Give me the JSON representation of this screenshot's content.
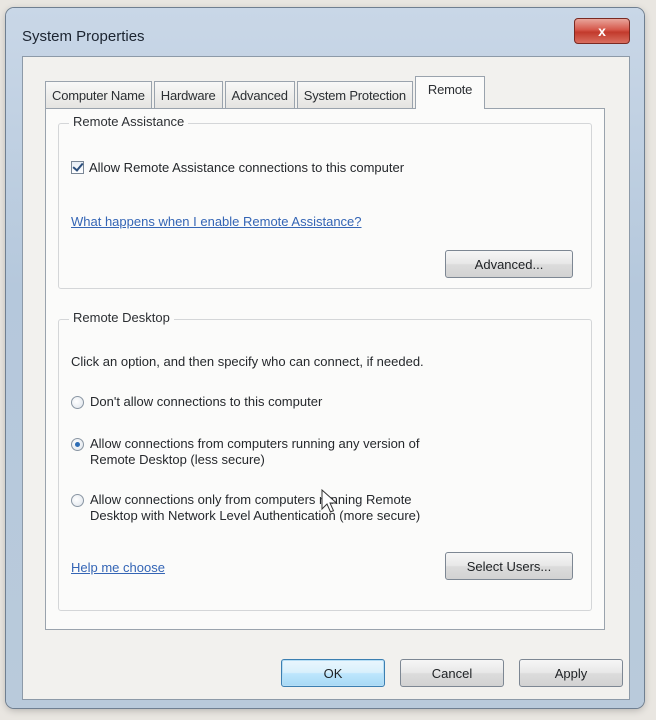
{
  "window": {
    "title": "System Properties",
    "close_label": "x"
  },
  "tabs": [
    {
      "label": "Computer Name",
      "active": false
    },
    {
      "label": "Hardware",
      "active": false
    },
    {
      "label": "Advanced",
      "active": false
    },
    {
      "label": "System Protection",
      "active": false
    },
    {
      "label": "Remote",
      "active": true
    }
  ],
  "remote_assistance": {
    "group_label": "Remote Assistance",
    "allow_checkbox_label": "Allow Remote Assistance connections to this computer",
    "allow_checked": true,
    "help_link": "What happens when I enable Remote Assistance?",
    "advanced_button": "Advanced..."
  },
  "remote_desktop": {
    "group_label": "Remote Desktop",
    "instructions": "Click an option, and then specify who can connect, if needed.",
    "options": [
      {
        "line1": "Don't allow connections to this computer",
        "line2": "",
        "selected": false
      },
      {
        "line1": "Allow connections from computers running any version of",
        "line2": "Remote Desktop (less secure)",
        "selected": true
      },
      {
        "line1": "Allow connections only from computers running Remote",
        "line2": "Desktop with Network Level Authentication (more secure)",
        "selected": false
      }
    ],
    "help_link": "Help me choose",
    "select_users_button": "Select Users..."
  },
  "footer": {
    "ok_label": "OK",
    "cancel_label": "Cancel",
    "apply_label": "Apply"
  },
  "colors": {
    "link": "#3465b5",
    "selected_radio": "#2e6db5",
    "close_button": "#c23a2c"
  },
  "icons": [
    "close-icon",
    "checkmark-icon",
    "mouse-pointer-icon"
  ]
}
